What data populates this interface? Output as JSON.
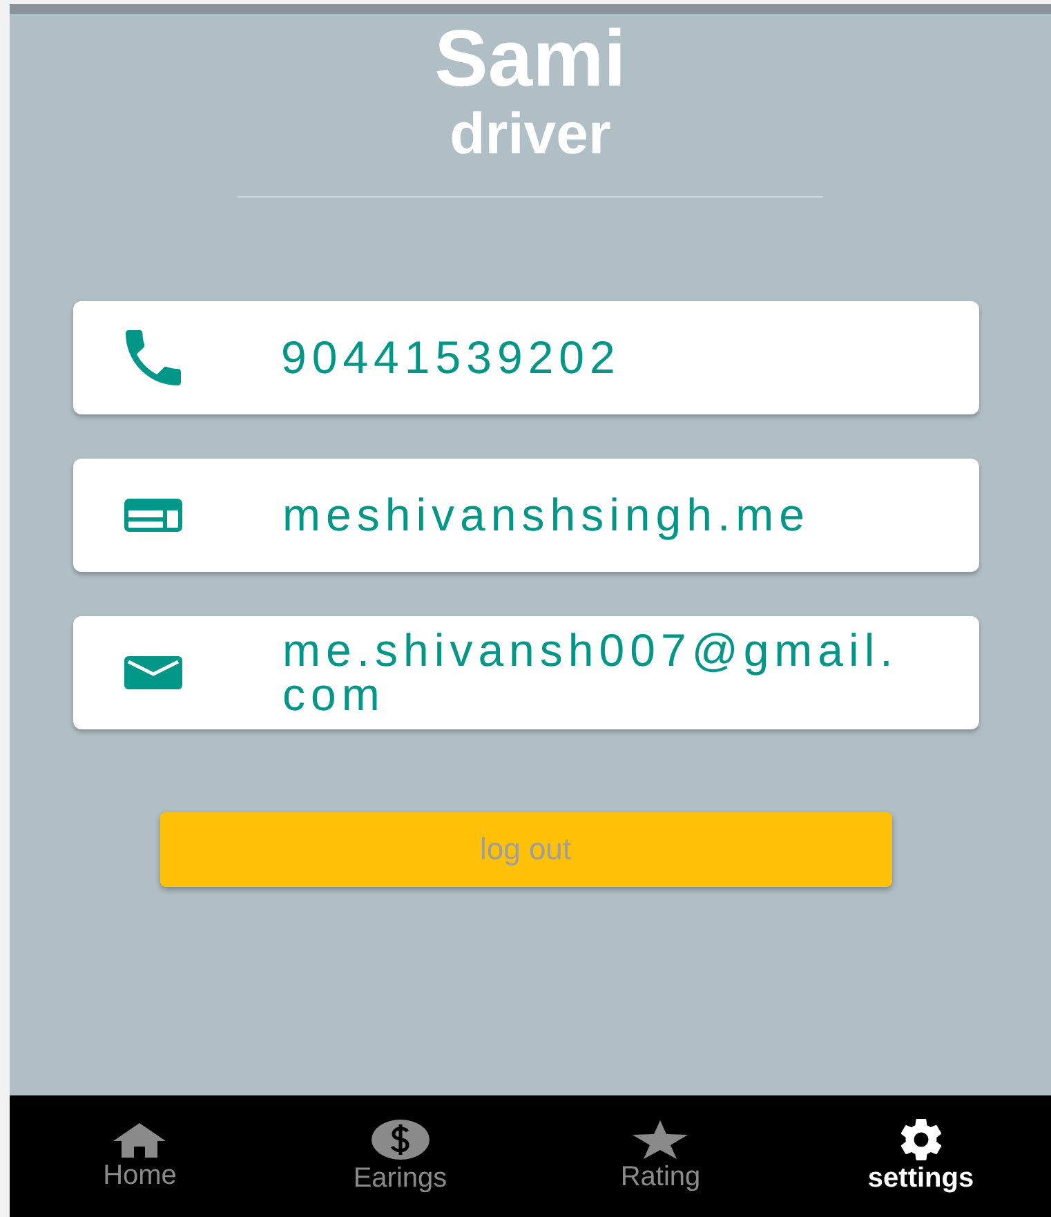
{
  "profile": {
    "name": "Sami",
    "role": "driver"
  },
  "contacts": [
    {
      "kind": "phone",
      "value": "90441539202"
    },
    {
      "kind": "website",
      "value": "meshivanshsingh.me"
    },
    {
      "kind": "email",
      "value": "me.shivansh007@gmail.com"
    }
  ],
  "logout_button": {
    "label": "log out"
  },
  "bottom_nav": [
    {
      "kind": "home",
      "label": "Home",
      "selected": false
    },
    {
      "kind": "earnings",
      "label": "Earings",
      "selected": false
    },
    {
      "kind": "rating",
      "label": "Rating",
      "selected": false
    },
    {
      "kind": "settings",
      "label": "settings",
      "selected": true
    }
  ]
}
